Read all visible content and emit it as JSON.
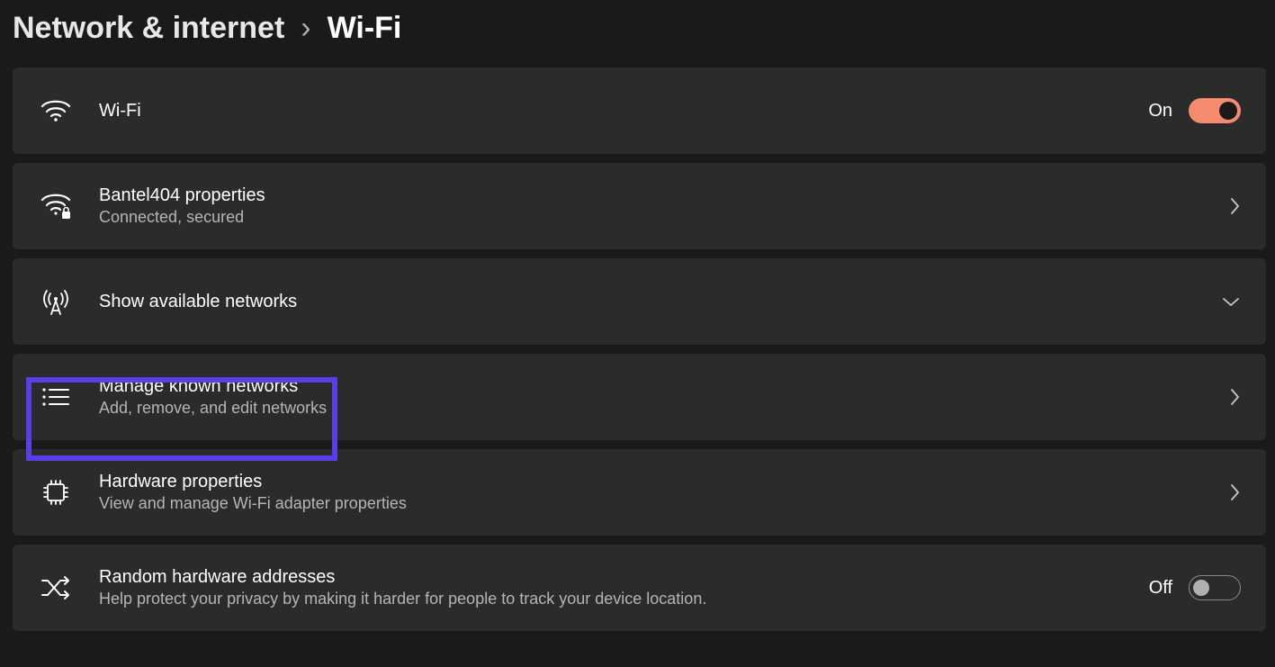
{
  "breadcrumb": {
    "parent": "Network & internet",
    "separator": "›",
    "current": "Wi-Fi"
  },
  "panels": {
    "wifi_toggle": {
      "title": "Wi-Fi",
      "state_label": "On"
    },
    "network_properties": {
      "title": "Bantel404 properties",
      "subtitle": "Connected, secured"
    },
    "available_networks": {
      "title": "Show available networks"
    },
    "manage_known": {
      "title": "Manage known networks",
      "subtitle": "Add, remove, and edit networks"
    },
    "hardware_properties": {
      "title": "Hardware properties",
      "subtitle": "View and manage Wi-Fi adapter properties"
    },
    "random_hw": {
      "title": "Random hardware addresses",
      "subtitle": "Help protect your privacy by making it harder for people to track your device location.",
      "state_label": "Off"
    }
  },
  "colors": {
    "accent_toggle_on": "#f78b6f",
    "highlight_border": "#5a3ee8"
  }
}
